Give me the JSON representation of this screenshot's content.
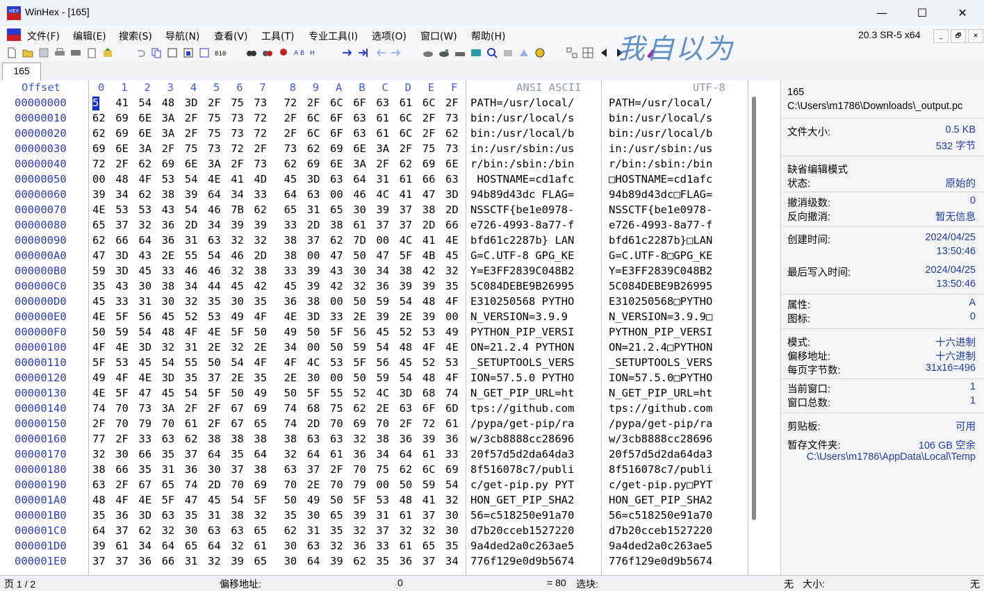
{
  "window": {
    "title": "WinHex - [165]",
    "minimize": "—",
    "maximize": "☐",
    "close": "✕",
    "logo_text": "HEX"
  },
  "menu": [
    "文件(F)",
    "编辑(E)",
    "搜索(S)",
    "导航(N)",
    "查看(V)",
    "工具(T)",
    "专业工具(I)",
    "选项(O)",
    "窗口(W)",
    "帮助(H)"
  ],
  "version": "20.3 SR-5 x64",
  "mdi_buttons": [
    "_",
    "🗗",
    "✕"
  ],
  "watermark": "我自以为",
  "tabs": [
    "165"
  ],
  "hex": {
    "offset_header": "Offset",
    "col_headers": [
      "0",
      "1",
      "2",
      "3",
      "4",
      "5",
      "6",
      "7",
      "8",
      "9",
      "A",
      "B",
      "C",
      "D",
      "E",
      "F"
    ],
    "ansi_header": "ANSI ASCII",
    "utf8_header": "UTF-8",
    "rows": [
      {
        "o": "00000000",
        "b": [
          "50",
          "41",
          "54",
          "48",
          "3D",
          "2F",
          "75",
          "73",
          "72",
          "2F",
          "6C",
          "6F",
          "63",
          "61",
          "6C",
          "2F"
        ],
        "a": "PATH=/usr/local/",
        "u": "PATH=/usr/local/"
      },
      {
        "o": "00000010",
        "b": [
          "62",
          "69",
          "6E",
          "3A",
          "2F",
          "75",
          "73",
          "72",
          "2F",
          "6C",
          "6F",
          "63",
          "61",
          "6C",
          "2F",
          "73"
        ],
        "a": "bin:/usr/local/s",
        "u": "bin:/usr/local/s"
      },
      {
        "o": "00000020",
        "b": [
          "62",
          "69",
          "6E",
          "3A",
          "2F",
          "75",
          "73",
          "72",
          "2F",
          "6C",
          "6F",
          "63",
          "61",
          "6C",
          "2F",
          "62"
        ],
        "a": "bin:/usr/local/b",
        "u": "bin:/usr/local/b"
      },
      {
        "o": "00000030",
        "b": [
          "69",
          "6E",
          "3A",
          "2F",
          "75",
          "73",
          "72",
          "2F",
          "73",
          "62",
          "69",
          "6E",
          "3A",
          "2F",
          "75",
          "73"
        ],
        "a": "in:/usr/sbin:/us",
        "u": "in:/usr/sbin:/us"
      },
      {
        "o": "00000040",
        "b": [
          "72",
          "2F",
          "62",
          "69",
          "6E",
          "3A",
          "2F",
          "73",
          "62",
          "69",
          "6E",
          "3A",
          "2F",
          "62",
          "69",
          "6E"
        ],
        "a": "r/bin:/sbin:/bin",
        "u": "r/bin:/sbin:/bin"
      },
      {
        "o": "00000050",
        "b": [
          "00",
          "48",
          "4F",
          "53",
          "54",
          "4E",
          "41",
          "4D",
          "45",
          "3D",
          "63",
          "64",
          "31",
          "61",
          "66",
          "63"
        ],
        "a": " HOSTNAME=cd1afc",
        "u": "□HOSTNAME=cd1afc"
      },
      {
        "o": "00000060",
        "b": [
          "39",
          "34",
          "62",
          "38",
          "39",
          "64",
          "34",
          "33",
          "64",
          "63",
          "00",
          "46",
          "4C",
          "41",
          "47",
          "3D"
        ],
        "a": "94b89d43dc FLAG=",
        "u": "94b89d43dc□FLAG="
      },
      {
        "o": "00000070",
        "b": [
          "4E",
          "53",
          "53",
          "43",
          "54",
          "46",
          "7B",
          "62",
          "65",
          "31",
          "65",
          "30",
          "39",
          "37",
          "38",
          "2D"
        ],
        "a": "NSSCTF{be1e0978-",
        "u": "NSSCTF{be1e0978-"
      },
      {
        "o": "00000080",
        "b": [
          "65",
          "37",
          "32",
          "36",
          "2D",
          "34",
          "39",
          "39",
          "33",
          "2D",
          "38",
          "61",
          "37",
          "37",
          "2D",
          "66"
        ],
        "a": "e726-4993-8a77-f",
        "u": "e726-4993-8a77-f"
      },
      {
        "o": "00000090",
        "b": [
          "62",
          "66",
          "64",
          "36",
          "31",
          "63",
          "32",
          "32",
          "38",
          "37",
          "62",
          "7D",
          "00",
          "4C",
          "41",
          "4E"
        ],
        "a": "bfd61c2287b} LAN",
        "u": "bfd61c2287b}□LAN"
      },
      {
        "o": "000000A0",
        "b": [
          "47",
          "3D",
          "43",
          "2E",
          "55",
          "54",
          "46",
          "2D",
          "38",
          "00",
          "47",
          "50",
          "47",
          "5F",
          "4B",
          "45"
        ],
        "a": "G=C.UTF-8 GPG_KE",
        "u": "G=C.UTF-8□GPG_KE"
      },
      {
        "o": "000000B0",
        "b": [
          "59",
          "3D",
          "45",
          "33",
          "46",
          "46",
          "32",
          "38",
          "33",
          "39",
          "43",
          "30",
          "34",
          "38",
          "42",
          "32"
        ],
        "a": "Y=E3FF2839C048B2",
        "u": "Y=E3FF2839C048B2"
      },
      {
        "o": "000000C0",
        "b": [
          "35",
          "43",
          "30",
          "38",
          "34",
          "44",
          "45",
          "42",
          "45",
          "39",
          "42",
          "32",
          "36",
          "39",
          "39",
          "35"
        ],
        "a": "5C084DEBE9B26995",
        "u": "5C084DEBE9B26995"
      },
      {
        "o": "000000D0",
        "b": [
          "45",
          "33",
          "31",
          "30",
          "32",
          "35",
          "30",
          "35",
          "36",
          "38",
          "00",
          "50",
          "59",
          "54",
          "48",
          "4F"
        ],
        "a": "E310250568 PYTHO",
        "u": "E310250568□PYTHO"
      },
      {
        "o": "000000E0",
        "b": [
          "4E",
          "5F",
          "56",
          "45",
          "52",
          "53",
          "49",
          "4F",
          "4E",
          "3D",
          "33",
          "2E",
          "39",
          "2E",
          "39",
          "00"
        ],
        "a": "N_VERSION=3.9.9 ",
        "u": "N_VERSION=3.9.9□"
      },
      {
        "o": "000000F0",
        "b": [
          "50",
          "59",
          "54",
          "48",
          "4F",
          "4E",
          "5F",
          "50",
          "49",
          "50",
          "5F",
          "56",
          "45",
          "52",
          "53",
          "49"
        ],
        "a": "PYTHON_PIP_VERSI",
        "u": "PYTHON_PIP_VERSI"
      },
      {
        "o": "00000100",
        "b": [
          "4F",
          "4E",
          "3D",
          "32",
          "31",
          "2E",
          "32",
          "2E",
          "34",
          "00",
          "50",
          "59",
          "54",
          "48",
          "4F",
          "4E"
        ],
        "a": "ON=21.2.4 PYTHON",
        "u": "ON=21.2.4□PYTHON"
      },
      {
        "o": "00000110",
        "b": [
          "5F",
          "53",
          "45",
          "54",
          "55",
          "50",
          "54",
          "4F",
          "4F",
          "4C",
          "53",
          "5F",
          "56",
          "45",
          "52",
          "53"
        ],
        "a": "_SETUPTOOLS_VERS",
        "u": "_SETUPTOOLS_VERS"
      },
      {
        "o": "00000120",
        "b": [
          "49",
          "4F",
          "4E",
          "3D",
          "35",
          "37",
          "2E",
          "35",
          "2E",
          "30",
          "00",
          "50",
          "59",
          "54",
          "48",
          "4F"
        ],
        "a": "ION=57.5.0 PYTHO",
        "u": "ION=57.5.0□PYTHO"
      },
      {
        "o": "00000130",
        "b": [
          "4E",
          "5F",
          "47",
          "45",
          "54",
          "5F",
          "50",
          "49",
          "50",
          "5F",
          "55",
          "52",
          "4C",
          "3D",
          "68",
          "74"
        ],
        "a": "N_GET_PIP_URL=ht",
        "u": "N_GET_PIP_URL=ht"
      },
      {
        "o": "00000140",
        "b": [
          "74",
          "70",
          "73",
          "3A",
          "2F",
          "2F",
          "67",
          "69",
          "74",
          "68",
          "75",
          "62",
          "2E",
          "63",
          "6F",
          "6D"
        ],
        "a": "tps://github.com",
        "u": "tps://github.com"
      },
      {
        "o": "00000150",
        "b": [
          "2F",
          "70",
          "79",
          "70",
          "61",
          "2F",
          "67",
          "65",
          "74",
          "2D",
          "70",
          "69",
          "70",
          "2F",
          "72",
          "61"
        ],
        "a": "/pypa/get-pip/ra",
        "u": "/pypa/get-pip/ra"
      },
      {
        "o": "00000160",
        "b": [
          "77",
          "2F",
          "33",
          "63",
          "62",
          "38",
          "38",
          "38",
          "38",
          "63",
          "63",
          "32",
          "38",
          "36",
          "39",
          "36"
        ],
        "a": "w/3cb8888cc28696",
        "u": "w/3cb8888cc28696"
      },
      {
        "o": "00000170",
        "b": [
          "32",
          "30",
          "66",
          "35",
          "37",
          "64",
          "35",
          "64",
          "32",
          "64",
          "61",
          "36",
          "34",
          "64",
          "61",
          "33"
        ],
        "a": "20f57d5d2da64da3",
        "u": "20f57d5d2da64da3"
      },
      {
        "o": "00000180",
        "b": [
          "38",
          "66",
          "35",
          "31",
          "36",
          "30",
          "37",
          "38",
          "63",
          "37",
          "2F",
          "70",
          "75",
          "62",
          "6C",
          "69"
        ],
        "a": "8f516078c7/publi",
        "u": "8f516078c7/publi"
      },
      {
        "o": "00000190",
        "b": [
          "63",
          "2F",
          "67",
          "65",
          "74",
          "2D",
          "70",
          "69",
          "70",
          "2E",
          "70",
          "79",
          "00",
          "50",
          "59",
          "54"
        ],
        "a": "c/get-pip.py PYT",
        "u": "c/get-pip.py□PYT"
      },
      {
        "o": "000001A0",
        "b": [
          "48",
          "4F",
          "4E",
          "5F",
          "47",
          "45",
          "54",
          "5F",
          "50",
          "49",
          "50",
          "5F",
          "53",
          "48",
          "41",
          "32"
        ],
        "a": "HON_GET_PIP_SHA2",
        "u": "HON_GET_PIP_SHA2"
      },
      {
        "o": "000001B0",
        "b": [
          "35",
          "36",
          "3D",
          "63",
          "35",
          "31",
          "38",
          "32",
          "35",
          "30",
          "65",
          "39",
          "31",
          "61",
          "37",
          "30"
        ],
        "a": "56=c518250e91a70",
        "u": "56=c518250e91a70"
      },
      {
        "o": "000001C0",
        "b": [
          "64",
          "37",
          "62",
          "32",
          "30",
          "63",
          "63",
          "65",
          "62",
          "31",
          "35",
          "32",
          "37",
          "32",
          "32",
          "30"
        ],
        "a": "d7b20cceb1527220",
        "u": "d7b20cceb1527220"
      },
      {
        "o": "000001D0",
        "b": [
          "39",
          "61",
          "34",
          "64",
          "65",
          "64",
          "32",
          "61",
          "30",
          "63",
          "32",
          "36",
          "33",
          "61",
          "65",
          "35"
        ],
        "a": "9a4ded2a0c263ae5",
        "u": "9a4ded2a0c263ae5"
      },
      {
        "o": "000001E0",
        "b": [
          "37",
          "37",
          "36",
          "66",
          "31",
          "32",
          "39",
          "65",
          "30",
          "64",
          "39",
          "62",
          "35",
          "36",
          "37",
          "34"
        ],
        "a": "776f129e0d9b5674",
        "u": "776f129e0d9b5674"
      }
    ]
  },
  "info": {
    "file_name": "165",
    "file_path": "C:\\Users\\m1786\\Downloads\\_output.pc",
    "file_size_label": "文件大小:",
    "file_size_kb": "0.5 KB",
    "file_size_bytes": "532 字节",
    "default_edit_mode": "缺省编辑模式",
    "state_label": "状态:",
    "state_value": "原始的",
    "undo_level_label": "撤消级数:",
    "undo_level_value": "0",
    "reverse_undo_label": "反向撤消:",
    "reverse_undo_value": "暂无信息",
    "created_label": "创建时间:",
    "created_date": "2024/04/25",
    "created_time": "13:50:46",
    "written_label": "最后写入时间:",
    "written_date": "2024/04/25",
    "written_time": "13:50:46",
    "attr_label": "属性:",
    "attr_value": "A",
    "icon_label": "图标:",
    "icon_value": "0",
    "mode_label": "模式:",
    "mode_value": "十六进制",
    "offset_label": "偏移地址:",
    "offset_value": "十六进制",
    "bytes_per_page_label": "每页字节数:",
    "bytes_per_page_value": "31x16=496",
    "cur_window_label": "当前窗口:",
    "cur_window_value": "1",
    "total_windows_label": "窗口总数:",
    "total_windows_value": "1",
    "clipboard_label": "剪贴板:",
    "clipboard_value": "可用",
    "temp_folder_label": "暂存文件夹:",
    "temp_folder_value": "106 GB 空余",
    "temp_path": "C:\\Users\\m1786\\AppData\\Local\\Temp"
  },
  "status": {
    "page": "页 1 / 2",
    "offset_label": "偏移地址:",
    "offset_value": "0",
    "eq_value": "= 80",
    "block_label": "选块:",
    "block_value": "无",
    "size_label": "大小:",
    "size_value": "无"
  },
  "colors": {
    "accent": "#1030c8",
    "offset_blue": "#2a3ccd",
    "header_blue": "#3c5adc",
    "info_blue": "#1e3ca8",
    "watermark": "#4b7fc0"
  }
}
